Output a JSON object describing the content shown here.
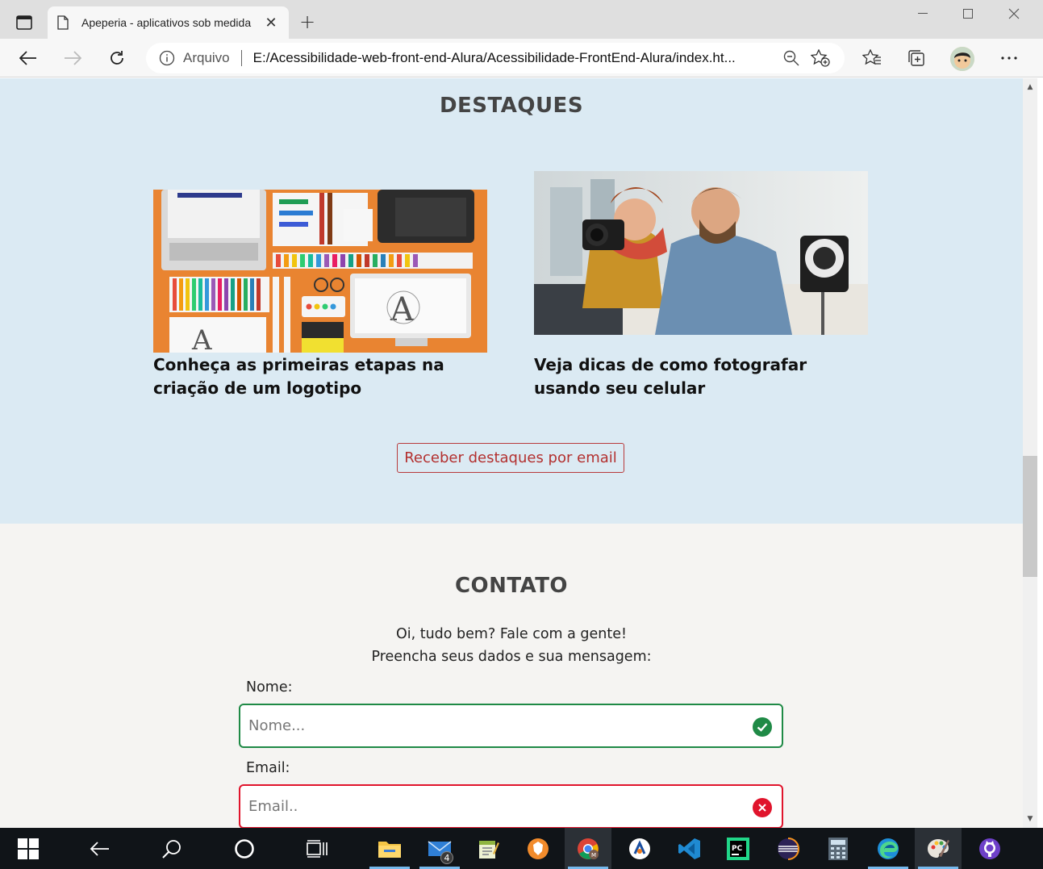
{
  "browser": {
    "tab_title": "Apeperia - aplicativos sob medida",
    "address_scheme": "Arquivo",
    "address_url": "E:/Acessibilidade-web-front-end-Alura/Acessibilidade-FrontEnd-Alura/index.ht..."
  },
  "destaques": {
    "title": "DESTAQUES",
    "cards": [
      {
        "title": "Conheça as primeiras etapas na criação de um logotipo",
        "image": "design-tools-illustration"
      },
      {
        "title": "Veja dicas de como fotografar usando seu celular",
        "image": "photographers-with-camera-photo"
      }
    ],
    "email_button": "Receber destaques por email"
  },
  "contato": {
    "title": "CONTATO",
    "intro_line1": "Oi, tudo bem? Fale com a gente!",
    "intro_line2": "Preencha seus dados e sua mensagem:",
    "name_label": "Nome:",
    "name_placeholder": "Nome...",
    "email_label": "Email:",
    "email_placeholder": "Email..",
    "valid_color": "#1f8a46",
    "invalid_color": "#e0142c"
  },
  "taskbar": {
    "mail_badge": "4",
    "apps": [
      "start",
      "back",
      "search",
      "cortana",
      "task-view",
      "file-explorer",
      "mail",
      "notepad",
      "brave",
      "chrome",
      "arc",
      "vscode",
      "pycharm",
      "eclipse",
      "calculator",
      "edge",
      "paint",
      "github-desktop"
    ]
  },
  "colors": {
    "destaques_bg": "#dbeaf3",
    "contato_bg": "#f5f4f2",
    "button_accent": "#b3302f"
  }
}
